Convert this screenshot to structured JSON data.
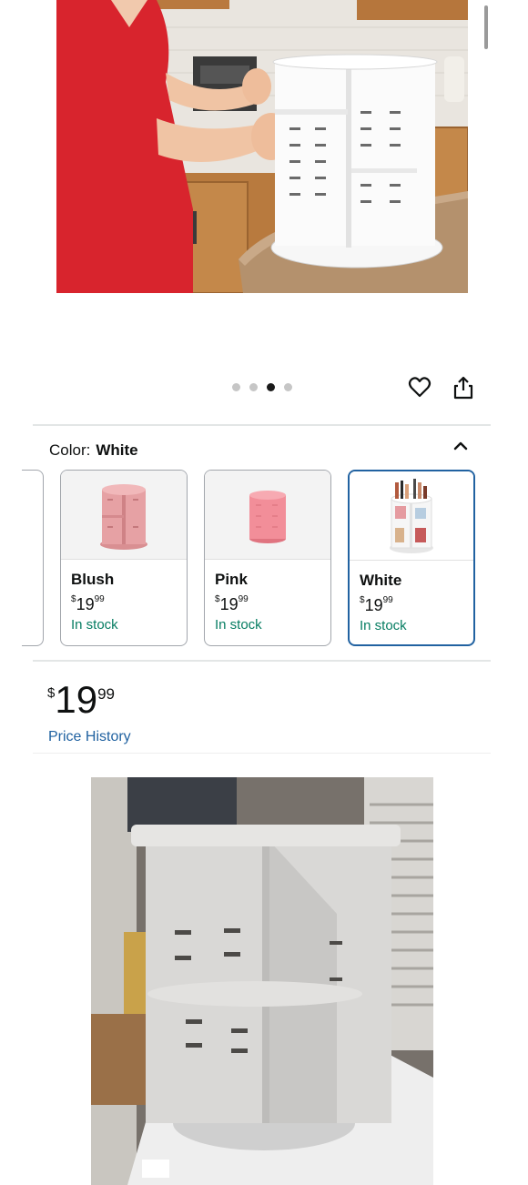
{
  "gallery": {
    "hero_image": "product-photo-woman-holding-rotating-organizer",
    "dot_count": 4,
    "active_dot": 2
  },
  "actions": {
    "wishlist_icon": "heart-icon",
    "share_icon": "share-icon"
  },
  "color_selector": {
    "label": "Color:",
    "selected": "White",
    "toggle_icon": "chevron-up-icon",
    "options": [
      {
        "name": "Blush",
        "price_currency": "$",
        "price_whole": "19",
        "price_fraction": "99",
        "stock": "In stock",
        "color": "#e8a4a6"
      },
      {
        "name": "Pink",
        "price_currency": "$",
        "price_whole": "19",
        "price_fraction": "99",
        "stock": "In stock",
        "color": "#f08c96"
      },
      {
        "name": "White",
        "price_currency": "$",
        "price_whole": "19",
        "price_fraction": "99",
        "stock": "In stock",
        "color": "#f4f4f4"
      }
    ]
  },
  "price": {
    "currency": "$",
    "whole": "19",
    "fraction": "99",
    "history_link": "Price History"
  },
  "review_image": "customer-photo-white-organizer-on-box",
  "colors": {
    "link": "#2162a1",
    "in_stock": "#067d62",
    "selected_border": "#2162a1",
    "text": "#0f1111"
  }
}
